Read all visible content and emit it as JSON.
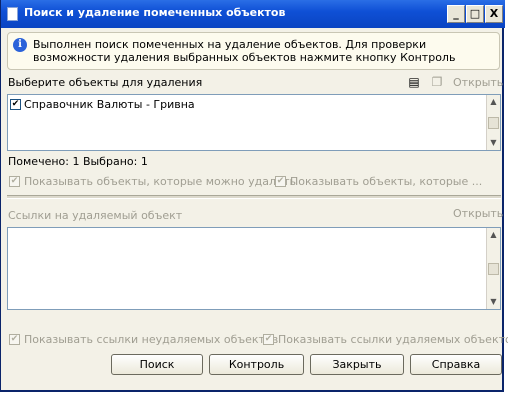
{
  "window": {
    "title": "Поиск и удаление помеченных объектов",
    "min": "_",
    "max": "□",
    "close": "X"
  },
  "info": {
    "icon": "i",
    "text": "Выполнен поиск помеченных на удаление объектов. Для проверки возможности удаления выбранных объектов нажмите кнопку Контроль"
  },
  "objects": {
    "header": "Выберите объекты для удаления",
    "open_label": "Открыть",
    "items": [
      {
        "checked": true,
        "label": "Справочник Валюты - Гривна"
      }
    ],
    "status": "Помечено: 1  Выбрано: 1",
    "show_deletable": "Показывать объекты, которые можно удалить",
    "show_other": "Показывать объекты, которые ..."
  },
  "refs": {
    "header": "Ссылки на удаляемый объект",
    "open_label": "Открыть",
    "show_nondeletable": "Показывать ссылки неудаляемых объектов",
    "show_deletable": "Показывать ссылки удаляемых объектов"
  },
  "buttons": {
    "search": "Поиск",
    "control": "Контроль",
    "close": "Закрыть",
    "help": "Справка"
  },
  "check_mark": "✔",
  "icons": [
    "document-icon",
    "check-all-icon",
    "copy-icon",
    "info-icon",
    "scroll-up-arrow",
    "scroll-down-arrow"
  ]
}
